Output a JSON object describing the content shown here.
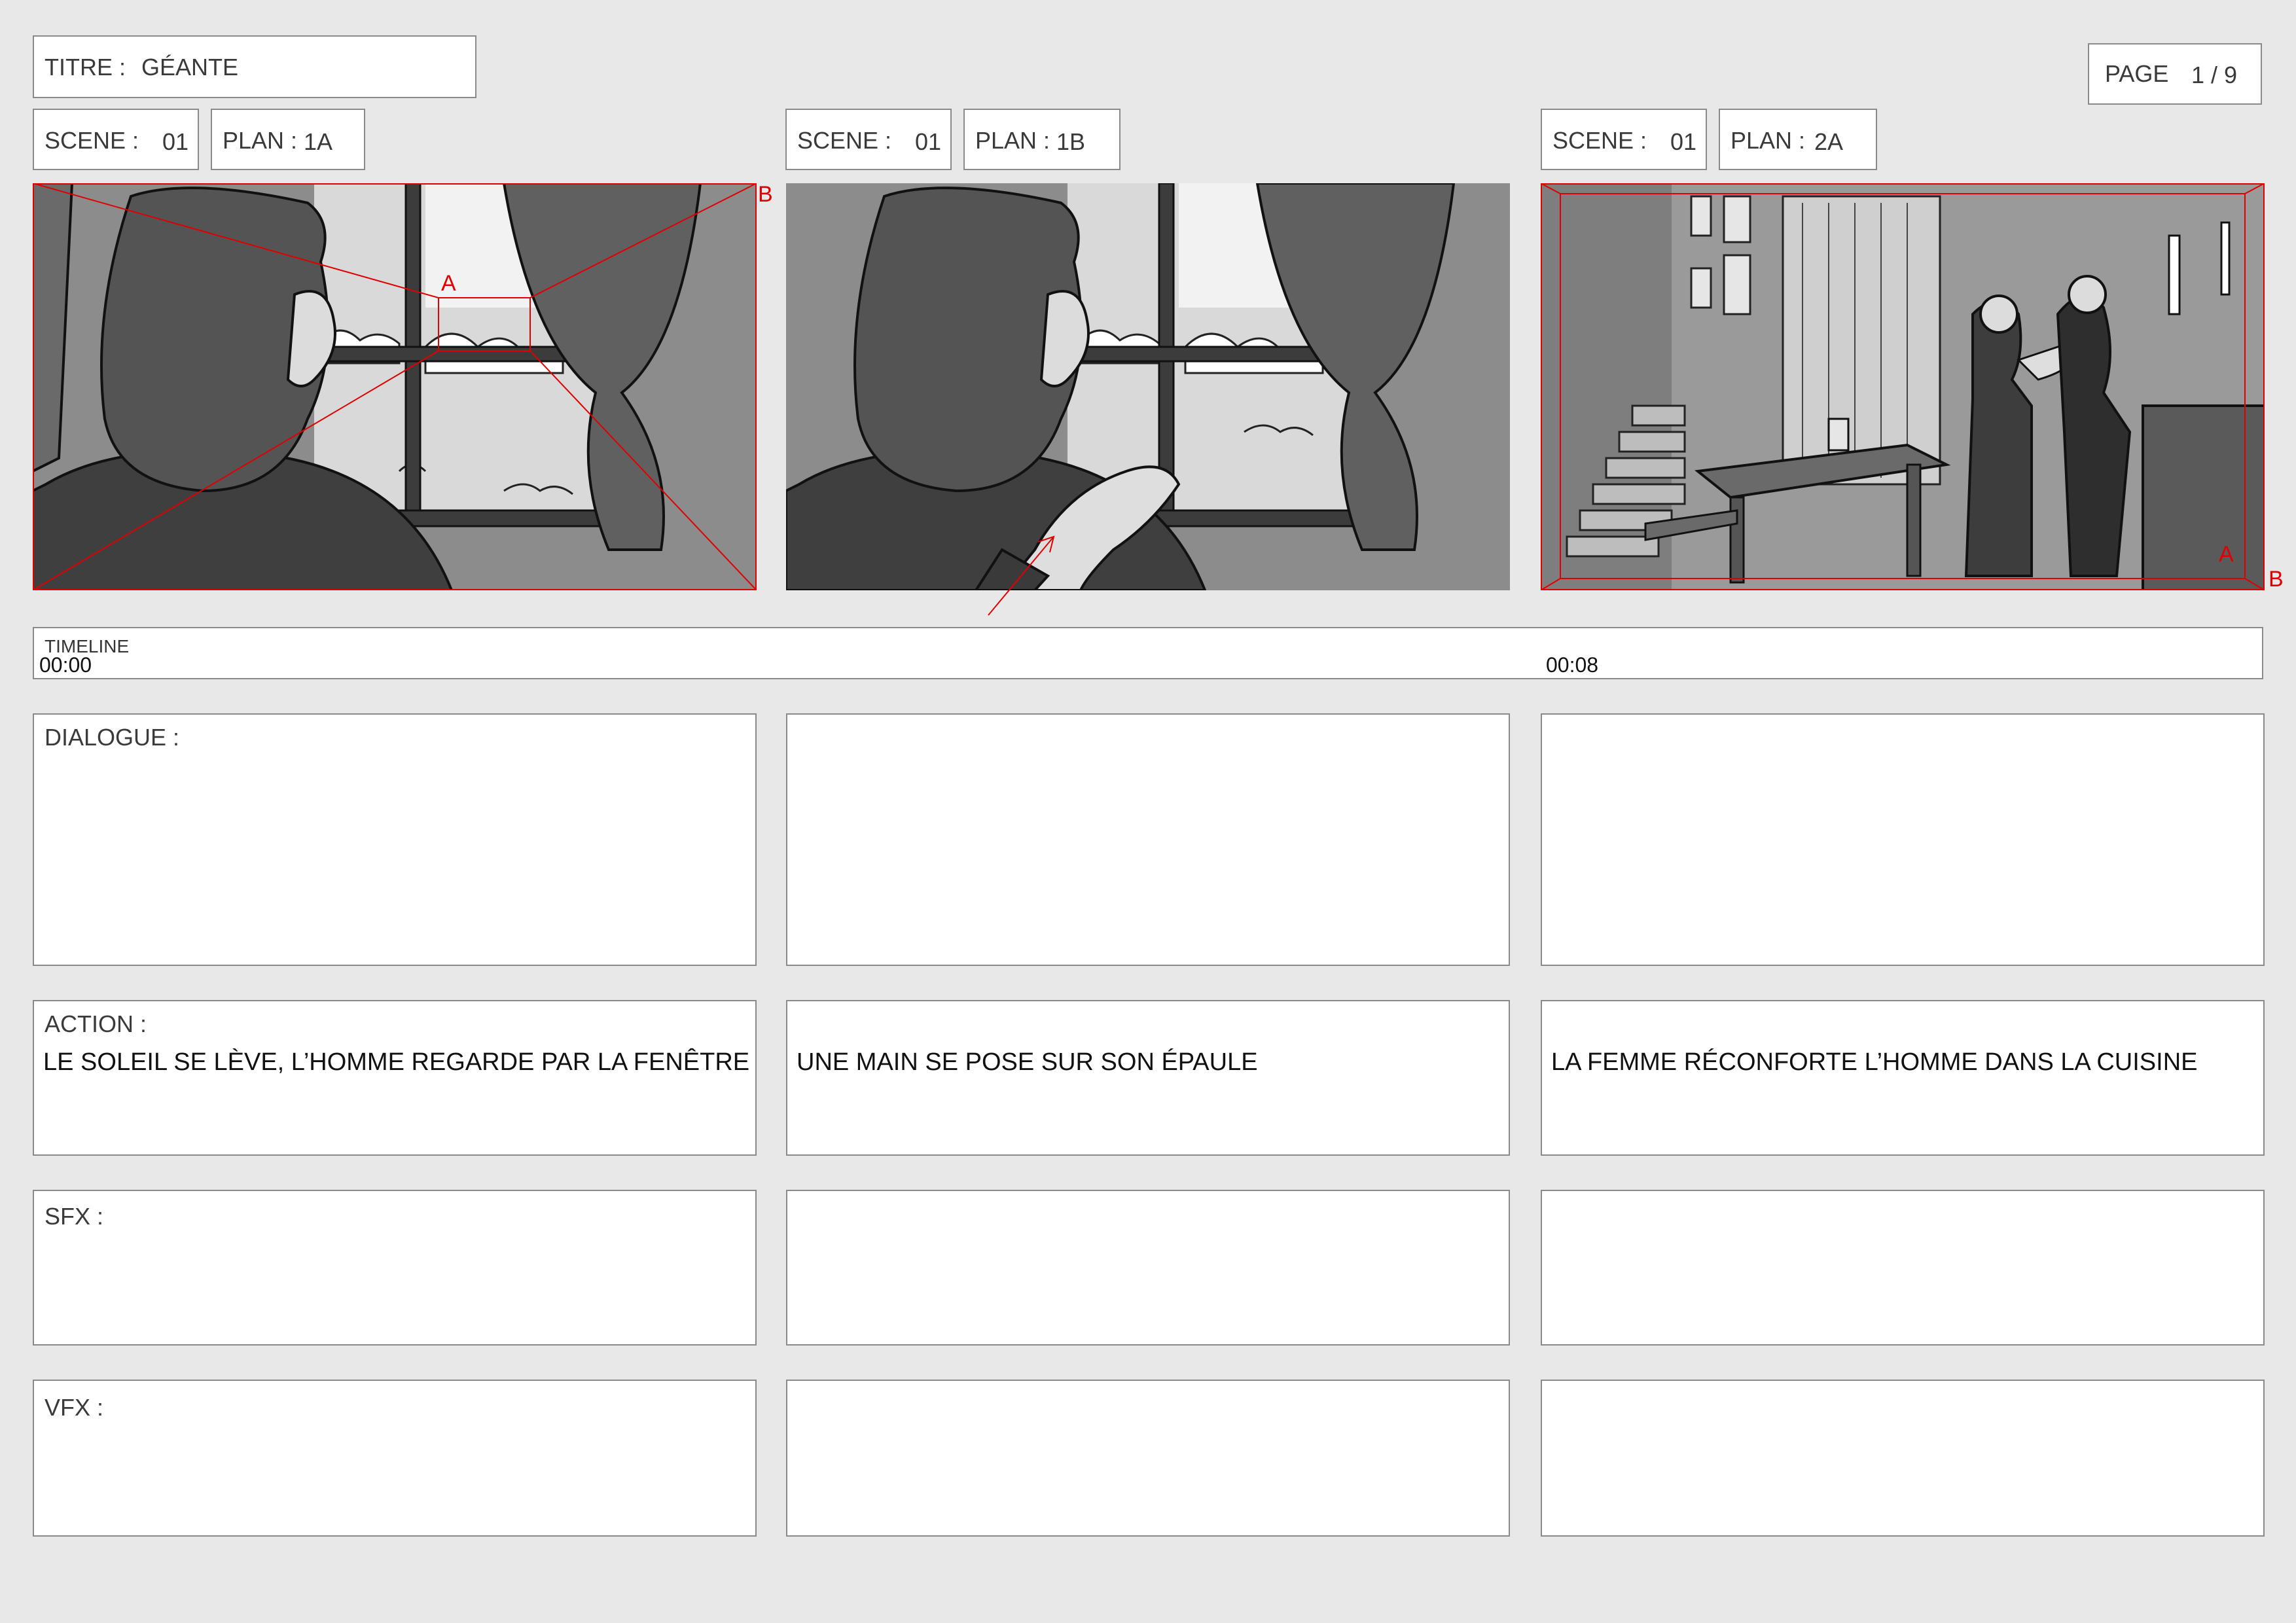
{
  "header": {
    "title_label": "TITRE :",
    "title_value": "GÉANTE",
    "page_label": "PAGE",
    "page_value": "1 / 9"
  },
  "shots": [
    {
      "scene_label": "SCENE :",
      "scene_value": "01",
      "plan_label": "PLAN :",
      "plan_value": "1A",
      "action": "LE SOLEIL SE LÈVE, L’HOMME REGARDE PAR LA FENÊTRE",
      "marker_a": "A",
      "marker_b": "B"
    },
    {
      "scene_label": "SCENE :",
      "scene_value": "01",
      "plan_label": "PLAN :",
      "plan_value": "1B",
      "action": "UNE MAIN SE POSE SUR  SON ÉPAULE"
    },
    {
      "scene_label": "SCENE :",
      "scene_value": "01",
      "plan_label": "PLAN :",
      "plan_value": "2A",
      "action": "LA FEMME RÉCONFORTE L’HOMME DANS LA CUISINE",
      "marker_a": "A",
      "marker_b": "B"
    }
  ],
  "timeline": {
    "label": "TIMELINE",
    "start": "00:00",
    "mark": "00:08"
  },
  "rows": {
    "dialogue": "DIALOGUE :",
    "action": "ACTION :",
    "sfx": "SFX :",
    "vfx": "VFX :"
  },
  "colors": {
    "page_bg": "#e8e8e8",
    "box_border": "#8a8a8a",
    "camera_marks": "#e00000"
  }
}
